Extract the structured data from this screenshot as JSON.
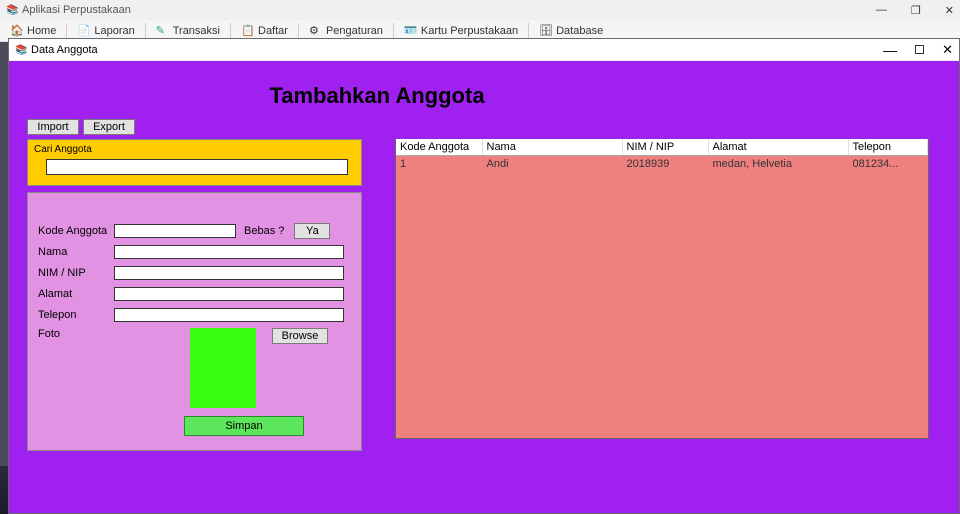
{
  "app": {
    "title": "Aplikasi Perpustakaan"
  },
  "win_controls": {
    "min": "—",
    "max": "❐",
    "close": "✕"
  },
  "menu": [
    {
      "label": "Home",
      "icon": "ic-home"
    },
    {
      "label": "Laporan",
      "icon": "ic-report"
    },
    {
      "label": "Transaksi",
      "icon": "ic-trans"
    },
    {
      "label": "Daftar",
      "icon": "ic-list"
    },
    {
      "label": "Pengaturan",
      "icon": "ic-gear"
    },
    {
      "label": "Kartu Perpustakaan",
      "icon": "ic-card"
    },
    {
      "label": "Database",
      "icon": "ic-db"
    }
  ],
  "child": {
    "title": "Data Anggota"
  },
  "heading": "Tambahkan Anggota",
  "buttons": {
    "import": "Import",
    "export": "Export",
    "browse": "Browse",
    "save": "Simpan",
    "ya": "Ya"
  },
  "search": {
    "label": "Cari Anggota",
    "value": ""
  },
  "form": {
    "kode_label": "Kode Anggota",
    "kode_value": "",
    "bebas_label": "Bebas  ?",
    "nama_label": "Nama",
    "nama_value": "",
    "nim_label": "NIM / NIP",
    "nim_value": "",
    "alamat_label": "Alamat",
    "alamat_value": "",
    "telepon_label": "Telepon",
    "telepon_value": "",
    "foto_label": "Foto"
  },
  "grid": {
    "headers": {
      "kode": "Kode Anggota",
      "nama": "Nama",
      "nim": "NIM / NIP",
      "alamat": "Alamat",
      "telepon": "Telepon"
    },
    "rows": [
      {
        "kode": "1",
        "nama": "Andi",
        "nim": "2018939",
        "alamat": "medan, Helvetia",
        "telepon": "081234..."
      }
    ]
  }
}
